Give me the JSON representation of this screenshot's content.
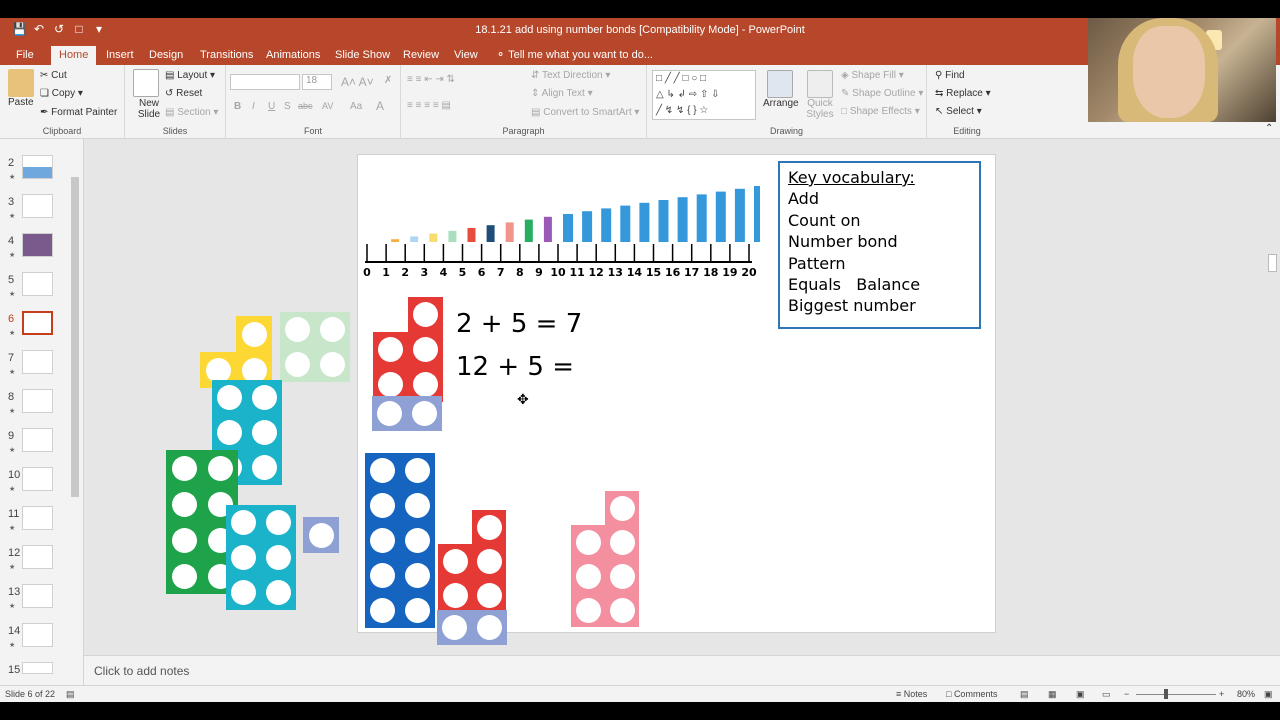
{
  "window": {
    "title": "18.1.21 add using number bonds [Compatibility Mode] - PowerPoint"
  },
  "ribbon_tabs": [
    "File",
    "Home",
    "Insert",
    "Design",
    "Transitions",
    "Animations",
    "Slide Show",
    "Review",
    "View"
  ],
  "active_tab": "Home",
  "tell_me": "Tell me what you want to do...",
  "clipboard": {
    "paste": "Paste",
    "cut": "Cut",
    "copy": "Copy",
    "format_painter": "Format Painter",
    "label": "Clipboard"
  },
  "slides_group": {
    "new_slide": "New Slide",
    "layout": "Layout",
    "reset": "Reset",
    "section": "Section",
    "label": "Slides"
  },
  "font_group": {
    "size": "18",
    "label": "Font",
    "bold": "B",
    "italic": "I",
    "underline": "U",
    "shadow": "S",
    "strike": "abc",
    "spacing": "AV"
  },
  "paragraph_group": {
    "text_direction": "Text Direction",
    "align_text": "Align Text",
    "convert_smartart": "Convert to SmartArt",
    "label": "Paragraph"
  },
  "drawing_group": {
    "arrange": "Arrange",
    "quick_styles": "Quick Styles",
    "shape_fill": "Shape Fill",
    "shape_outline": "Shape Outline",
    "shape_effects": "Shape Effects",
    "label": "Drawing"
  },
  "editing_group": {
    "find": "Find",
    "replace": "Replace",
    "select": "Select",
    "label": "Editing"
  },
  "thumbnails": [
    "2",
    "3",
    "4",
    "5",
    "6",
    "7",
    "8",
    "9",
    "10",
    "11",
    "12",
    "13",
    "14",
    "15"
  ],
  "current_slide": "6",
  "slide": {
    "number_line": [
      "0",
      "1",
      "2",
      "3",
      "4",
      "5",
      "6",
      "7",
      "8",
      "9",
      "10",
      "11",
      "12",
      "13",
      "14",
      "15",
      "16",
      "17",
      "18",
      "19",
      "20"
    ],
    "equation1": "2 + 5 = 7",
    "equation2": "12 + 5 =",
    "vocab_title": "Key vocabulary:",
    "vocab_items": [
      "Add",
      "Count on",
      "Number bond",
      "Pattern",
      "Equals   Balance",
      "Biggest number"
    ]
  },
  "notes_placeholder": "Click to add notes",
  "status": {
    "slide_info": "Slide 6 of 22",
    "notes": "Notes",
    "comments": "Comments",
    "zoom": "80%"
  },
  "colors": {
    "accent": "#b7472a",
    "vocab_border": "#2e75b6"
  }
}
